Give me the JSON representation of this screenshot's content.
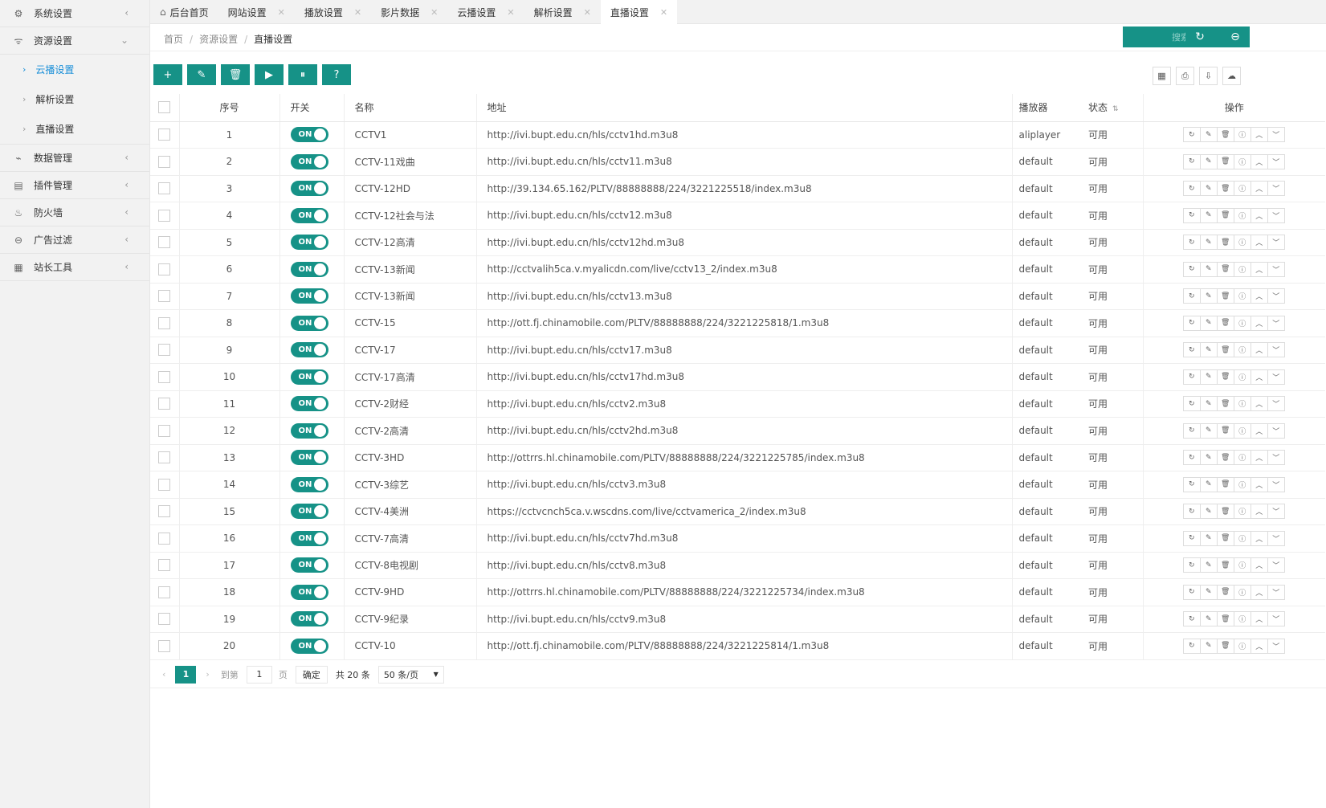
{
  "sidebar": {
    "menus": [
      {
        "label": "系统设置",
        "icon": "gear-icon",
        "glyph": "⚙",
        "arrow": "‹"
      },
      {
        "label": "资源设置",
        "icon": "rss-icon",
        "glyph": "ᯤ",
        "arrow": "⌄"
      },
      {
        "label": "数据管理",
        "icon": "pulse-icon",
        "glyph": "⌁",
        "arrow": "‹"
      },
      {
        "label": "插件管理",
        "icon": "plugin-icon",
        "glyph": "▤",
        "arrow": "‹"
      },
      {
        "label": "防火墙",
        "icon": "fire-icon",
        "glyph": "♨",
        "arrow": "‹"
      },
      {
        "label": "广告过滤",
        "icon": "filter-icon",
        "glyph": "⊖",
        "arrow": "‹"
      },
      {
        "label": "站长工具",
        "icon": "tools-icon",
        "glyph": "▦",
        "arrow": "‹"
      }
    ],
    "submenu": [
      {
        "label": "云播设置",
        "active": true
      },
      {
        "label": "解析设置",
        "active": false
      },
      {
        "label": "直播设置",
        "active": false
      }
    ]
  },
  "tabs": [
    {
      "label": "后台首页",
      "home": true,
      "closable": false,
      "active": false
    },
    {
      "label": "网站设置",
      "closable": true,
      "active": false
    },
    {
      "label": "播放设置",
      "closable": true,
      "active": false
    },
    {
      "label": "影片数据",
      "closable": true,
      "active": false
    },
    {
      "label": "云播设置",
      "closable": true,
      "active": false
    },
    {
      "label": "解析设置",
      "closable": true,
      "active": false
    },
    {
      "label": "直播设置",
      "closable": true,
      "active": true
    }
  ],
  "breadcrumb": [
    "首页",
    "资源设置",
    "直播设置"
  ],
  "header_actions": {
    "search_label": "搜索",
    "refresh_icon": "refresh-icon",
    "more_icon": "more-icon"
  },
  "toolbar": {
    "left": [
      {
        "name": "add-button",
        "glyph": "+"
      },
      {
        "name": "edit-button",
        "glyph": "✎"
      },
      {
        "name": "delete-button",
        "glyph": "🗑"
      },
      {
        "name": "enable-button",
        "glyph": "▶"
      },
      {
        "name": "disable-button",
        "glyph": "⏸"
      },
      {
        "name": "help-button",
        "glyph": "?"
      }
    ],
    "right": [
      {
        "name": "columns-button",
        "glyph": "▦"
      },
      {
        "name": "print-button",
        "glyph": "⎙"
      },
      {
        "name": "export-button",
        "glyph": "⇩"
      },
      {
        "name": "cloud-button",
        "glyph": "☁"
      }
    ]
  },
  "table": {
    "headers": {
      "no": "序号",
      "switch": "开关",
      "name": "名称",
      "url": "地址",
      "player": "播放器",
      "status": "状态",
      "ops": "操作"
    },
    "switch_label": "ON",
    "rows": [
      {
        "no": "1",
        "name": "CCTV1",
        "url": "http://ivi.bupt.edu.cn/hls/cctv1hd.m3u8",
        "player": "aliplayer",
        "status": "可用"
      },
      {
        "no": "2",
        "name": "CCTV-11戏曲",
        "url": "http://ivi.bupt.edu.cn/hls/cctv11.m3u8",
        "player": "default",
        "status": "可用"
      },
      {
        "no": "3",
        "name": "CCTV-12HD",
        "url": "http://39.134.65.162/PLTV/88888888/224/3221225518/index.m3u8",
        "player": "default",
        "status": "可用"
      },
      {
        "no": "4",
        "name": "CCTV-12社会与法",
        "url": "http://ivi.bupt.edu.cn/hls/cctv12.m3u8",
        "player": "default",
        "status": "可用"
      },
      {
        "no": "5",
        "name": "CCTV-12高清",
        "url": "http://ivi.bupt.edu.cn/hls/cctv12hd.m3u8",
        "player": "default",
        "status": "可用"
      },
      {
        "no": "6",
        "name": "CCTV-13新闻",
        "url": "http://cctvalih5ca.v.myalicdn.com/live/cctv13_2/index.m3u8",
        "player": "default",
        "status": "可用"
      },
      {
        "no": "7",
        "name": "CCTV-13新闻",
        "url": "http://ivi.bupt.edu.cn/hls/cctv13.m3u8",
        "player": "default",
        "status": "可用"
      },
      {
        "no": "8",
        "name": "CCTV-15",
        "url": "http://ott.fj.chinamobile.com/PLTV/88888888/224/3221225818/1.m3u8",
        "player": "default",
        "status": "可用"
      },
      {
        "no": "9",
        "name": "CCTV-17",
        "url": "http://ivi.bupt.edu.cn/hls/cctv17.m3u8",
        "player": "default",
        "status": "可用"
      },
      {
        "no": "10",
        "name": "CCTV-17高清",
        "url": "http://ivi.bupt.edu.cn/hls/cctv17hd.m3u8",
        "player": "default",
        "status": "可用"
      },
      {
        "no": "11",
        "name": "CCTV-2财经",
        "url": "http://ivi.bupt.edu.cn/hls/cctv2.m3u8",
        "player": "default",
        "status": "可用"
      },
      {
        "no": "12",
        "name": "CCTV-2高清",
        "url": "http://ivi.bupt.edu.cn/hls/cctv2hd.m3u8",
        "player": "default",
        "status": "可用"
      },
      {
        "no": "13",
        "name": "CCTV-3HD",
        "url": "http://ottrrs.hl.chinamobile.com/PLTV/88888888/224/3221225785/index.m3u8",
        "player": "default",
        "status": "可用"
      },
      {
        "no": "14",
        "name": "CCTV-3综艺",
        "url": "http://ivi.bupt.edu.cn/hls/cctv3.m3u8",
        "player": "default",
        "status": "可用"
      },
      {
        "no": "15",
        "name": "CCTV-4美洲",
        "url": "https://cctvcnch5ca.v.wscdns.com/live/cctvamerica_2/index.m3u8",
        "player": "default",
        "status": "可用"
      },
      {
        "no": "16",
        "name": "CCTV-7高清",
        "url": "http://ivi.bupt.edu.cn/hls/cctv7hd.m3u8",
        "player": "default",
        "status": "可用"
      },
      {
        "no": "17",
        "name": "CCTV-8电视剧",
        "url": "http://ivi.bupt.edu.cn/hls/cctv8.m3u8",
        "player": "default",
        "status": "可用"
      },
      {
        "no": "18",
        "name": "CCTV-9HD",
        "url": "http://ottrrs.hl.chinamobile.com/PLTV/88888888/224/3221225734/index.m3u8",
        "player": "default",
        "status": "可用"
      },
      {
        "no": "19",
        "name": "CCTV-9纪录",
        "url": "http://ivi.bupt.edu.cn/hls/cctv9.m3u8",
        "player": "default",
        "status": "可用"
      },
      {
        "no": "20",
        "name": "CCTV-10",
        "url": "http://ott.fj.chinamobile.com/PLTV/88888888/224/3221225814/1.m3u8",
        "player": "default",
        "status": "可用"
      }
    ],
    "row_ops": [
      {
        "name": "row-refresh-icon",
        "glyph": "↻"
      },
      {
        "name": "row-edit-icon",
        "glyph": "✎"
      },
      {
        "name": "row-delete-icon",
        "glyph": "🗑"
      },
      {
        "name": "row-info-icon",
        "glyph": "ⓘ"
      },
      {
        "name": "row-up-icon",
        "glyph": "︿"
      },
      {
        "name": "row-down-icon",
        "glyph": "﹀"
      }
    ]
  },
  "pagination": {
    "prev": "‹",
    "current": "1",
    "next": "›",
    "goto_label": "到第",
    "goto_value": "1",
    "page_unit": "页",
    "confirm": "确定",
    "total": "共 20 条",
    "page_size": "50 条/页"
  },
  "colors": {
    "accent": "#169287",
    "link": "#1a8fd8"
  }
}
